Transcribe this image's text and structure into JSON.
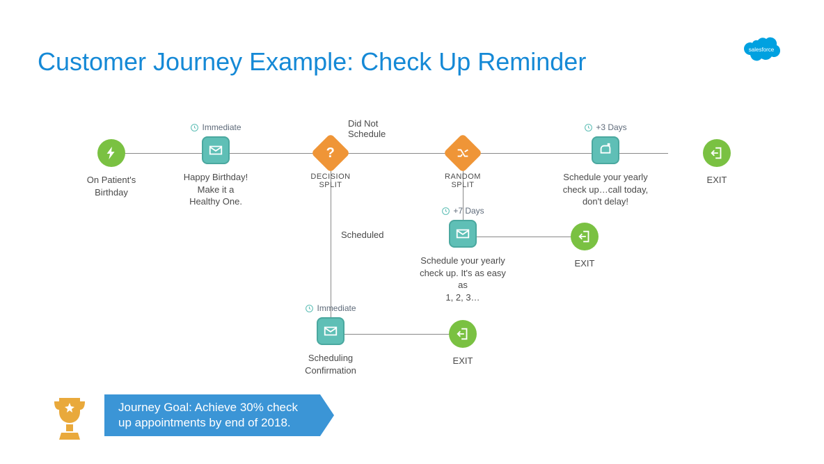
{
  "title": "Customer Journey Example: Check Up Reminder",
  "logo_text": "salesforce",
  "nodes": {
    "start": {
      "label": "On Patient's Birthday"
    },
    "email1": {
      "timing": "Immediate",
      "label": "Happy Birthday! Make it a Healthy One."
    },
    "decision": {
      "type_label": "DECISION SPLIT",
      "branch_top": "Did Not Schedule",
      "branch_bottom": "Scheduled"
    },
    "random": {
      "type_label": "RANDOM  SPLIT"
    },
    "email2": {
      "timing": "+7 Days",
      "label": "Schedule your yearly check up. It's as easy as\n1, 2, 3…"
    },
    "mail3": {
      "timing": "+3 Days",
      "label": "Schedule your yearly check up…call today, don't delay!"
    },
    "email4": {
      "timing": "Immediate",
      "label": "Scheduling Confirmation"
    },
    "exit1": {
      "label": "EXIT"
    },
    "exit2": {
      "label": "EXIT"
    },
    "exit3": {
      "label": "EXIT"
    }
  },
  "goal": "Journey Goal: Achieve 30% check up appointments by end of 2018."
}
